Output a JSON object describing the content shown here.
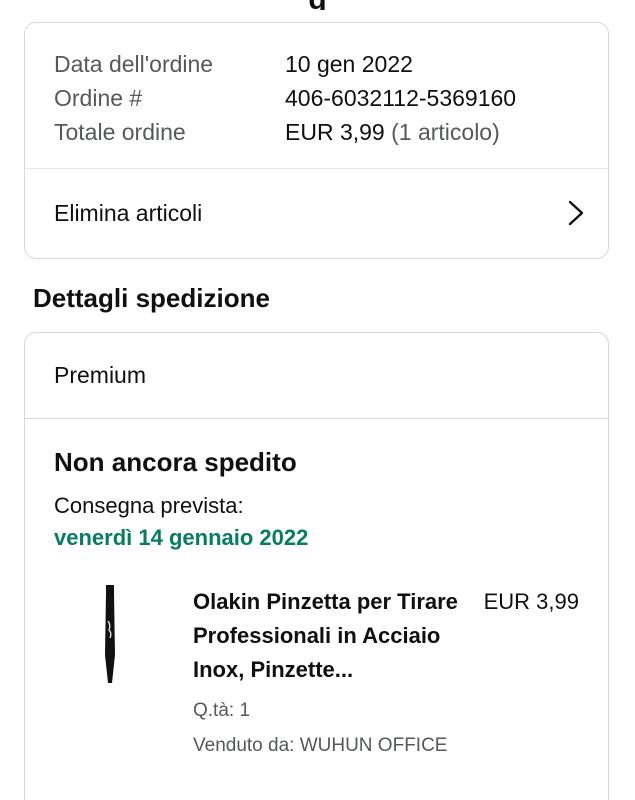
{
  "header": {
    "title_fragment": "g"
  },
  "order_summary": {
    "rows": [
      {
        "label": "Data dell'ordine",
        "value": "10 gen 2022"
      },
      {
        "label": "Ordine #",
        "value": "406-6032112-5369160"
      },
      {
        "label": "Totale ordine",
        "value": "EUR 3,99",
        "extra": "(1 articolo)"
      }
    ],
    "action_label": "Elimina articoli",
    "action_icon": "chevron-right-icon"
  },
  "shipment": {
    "section_title": "Dettagli spedizione",
    "method": "Premium",
    "status": "Non ancora spedito",
    "delivery_label": "Consegna prevista:",
    "delivery_date": "venerdì 14 gennaio 2022",
    "delivery_color": "#067d62",
    "item": {
      "title": "Olakin Pinzetta per Tirare Professionali in Acciaio Inox, Pinzette...",
      "price": "EUR 3,99",
      "quantity": "Q.tà: 1",
      "seller": "Venduto da: WUHUN OFFICE",
      "image_icon": "tweezers-image"
    }
  }
}
